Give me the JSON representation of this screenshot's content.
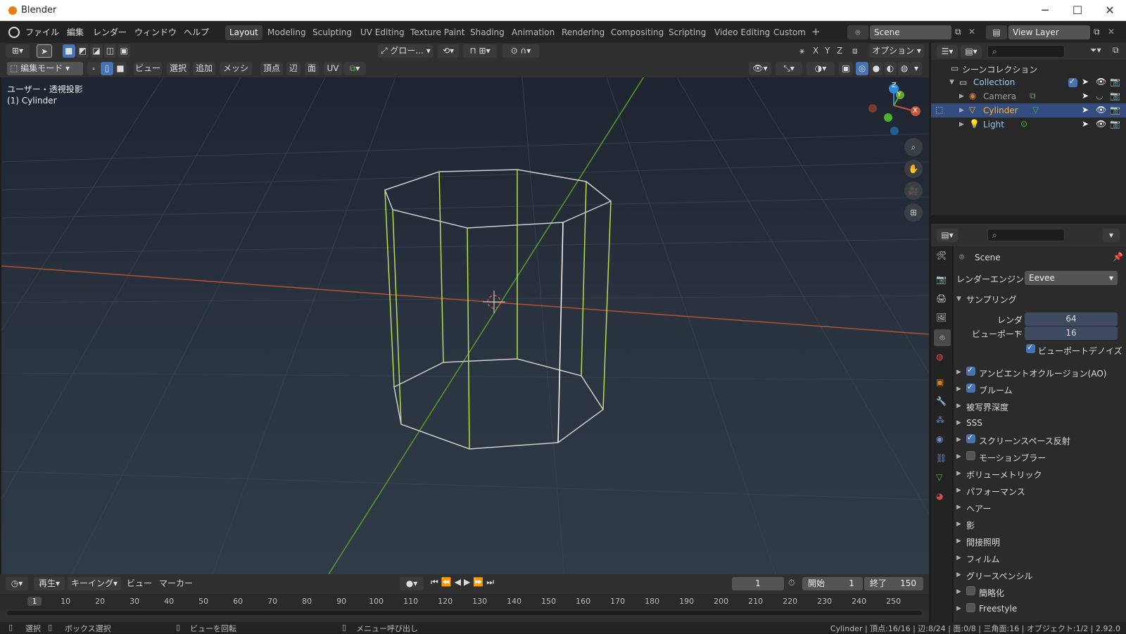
{
  "window": {
    "title": "Blender",
    "controls": [
      "─",
      "☐",
      "✕"
    ]
  },
  "menus": [
    "ファイル",
    "編集",
    "レンダー",
    "ウィンドウ",
    "ヘルプ"
  ],
  "workspaces": [
    "Layout",
    "Modeling",
    "Sculpting",
    "UV Editing",
    "Texture Paint",
    "Shading",
    "Animation",
    "Rendering",
    "Compositing",
    "Scripting",
    "Video Editing",
    "Custom"
  ],
  "scene_field": "Scene",
  "view_layer_field": "View Layer",
  "toolbar": {
    "transform_orientation": "グロー...",
    "axes": [
      "X",
      "Y",
      "Z"
    ],
    "options": "オプション"
  },
  "header": {
    "mode": "編集モード",
    "menus": [
      "ビュー",
      "選択",
      "追加",
      "メッシュ",
      "頂点",
      "辺",
      "面",
      "UV"
    ]
  },
  "viewport": {
    "view_name": "ユーザー・透視投影",
    "object_name": "(1) Cylinder",
    "gizmo": {
      "x": "X",
      "y": "Y",
      "z": "Z"
    }
  },
  "outliner": {
    "root": "シーンコレクション",
    "collection": "Collection",
    "items": [
      {
        "name": "Camera",
        "color": "#9a9a9a"
      },
      {
        "name": "Cylinder",
        "color": "#ffaf29"
      },
      {
        "name": "Light",
        "color": "#9cc4ef"
      }
    ]
  },
  "properties": {
    "context": "Scene",
    "render_engine_label": "レンダーエンジン",
    "render_engine": "Eevee",
    "sampling": "サンプリング",
    "render_label": "レンダー",
    "render_value": "64",
    "viewport_label": "ビューポート",
    "viewport_value": "16",
    "viewport_denoise": "ビューポートデノイズ",
    "panels": [
      {
        "label": "アンビエントオクルージョン(AO)",
        "check": "on"
      },
      {
        "label": "ブルーム",
        "check": "on"
      },
      {
        "label": "被写界深度",
        "check": "none"
      },
      {
        "label": "SSS",
        "check": "none"
      },
      {
        "label": "スクリーンスペース反射",
        "check": "on"
      },
      {
        "label": "モーションブラー",
        "check": "off"
      },
      {
        "label": "ボリューメトリック",
        "check": "none"
      },
      {
        "label": "パフォーマンス",
        "check": "none"
      },
      {
        "label": "ヘアー",
        "check": "none"
      },
      {
        "label": "影",
        "check": "none"
      },
      {
        "label": "間接照明",
        "check": "none"
      },
      {
        "label": "フィルム",
        "check": "none"
      },
      {
        "label": "グリースペンシル",
        "check": "none"
      },
      {
        "label": "簡略化",
        "check": "off"
      },
      {
        "label": "Freestyle",
        "check": "off"
      }
    ]
  },
  "timeline": {
    "playback": "再生",
    "keying": "キーイング",
    "view": "ビュー",
    "marker": "マーカー",
    "current_frame": "1",
    "start_label": "開始",
    "start": "1",
    "end_label": "終了",
    "end": "150",
    "ticks": [
      "1",
      "10",
      "20",
      "30",
      "40",
      "50",
      "60",
      "70",
      "80",
      "90",
      "100",
      "110",
      "120",
      "130",
      "140",
      "150",
      "160",
      "170",
      "180",
      "190",
      "200",
      "210",
      "220",
      "230",
      "240",
      "250"
    ]
  },
  "status": {
    "select": "選択",
    "box_select": "ボックス選択",
    "rotate_view": "ビューを回転",
    "call_menu": "メニュー呼び出し",
    "stats": "Cylinder | 頂点:16/16 | 辺:8/24 | 面:0/8 | 三角面:16 | オブジェクト:1/2 | 2.92.0"
  },
  "colors": {
    "accent": "#4772b3",
    "selected_edge": "#b5e04a",
    "x_axis": "#c2563a",
    "y_axis": "#6ba32d",
    "z_axis": "#2e8bdb"
  }
}
